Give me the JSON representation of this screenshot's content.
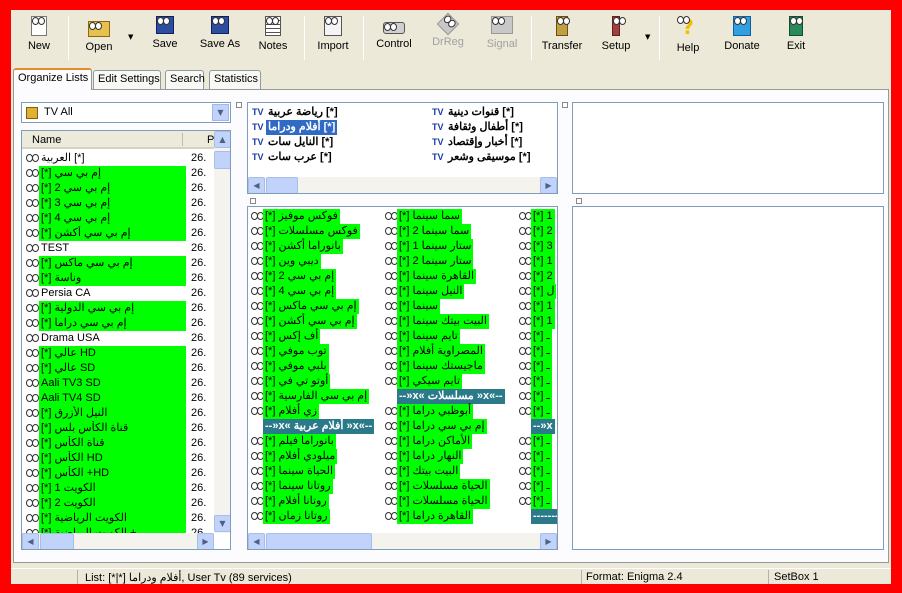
{
  "toolbar": {
    "new": "New",
    "open": "Open",
    "save": "Save",
    "save_as": "Save As",
    "notes": "Notes",
    "import": "Import",
    "control": "Control",
    "drreg": "DrReg",
    "signal": "Signal",
    "transfer": "Transfer",
    "setup": "Setup",
    "help": "Help",
    "donate": "Donate",
    "exit": "Exit"
  },
  "tabs": [
    "Organize Lists",
    "Edit Settings",
    "Search",
    "Statistics"
  ],
  "combo": {
    "value": "TV All"
  },
  "list": {
    "col_name": "Name",
    "col_num": "P",
    "rows": [
      {
        "name": "العربية [*]",
        "num": "26."
      },
      {
        "name": "[*] إم بي سي",
        "num": "26."
      },
      {
        "name": "[*] إم بي سي 2",
        "num": "26."
      },
      {
        "name": "[*] إم بي سي 3",
        "num": "26."
      },
      {
        "name": "[*] إم بي سي 4",
        "num": "26."
      },
      {
        "name": "[*] إم بي سي أكشن",
        "num": "26."
      },
      {
        "name": "TEST",
        "num": "26."
      },
      {
        "name": "[*] إم بي سي ماكس",
        "num": "26."
      },
      {
        "name": "[*] وناسة",
        "num": "26."
      },
      {
        "name": "Persia CA",
        "num": "26."
      },
      {
        "name": "[*] إم بي سي الدولية",
        "num": "26."
      },
      {
        "name": "[*] إم بي سي دراما",
        "num": "26."
      },
      {
        "name": "Drama USA",
        "num": "26."
      },
      {
        "name": "[*] عالي HD",
        "num": "26."
      },
      {
        "name": "[*] عالي SD",
        "num": "26."
      },
      {
        "name": "Aali TV3 SD",
        "num": "26."
      },
      {
        "name": "Aali TV4 SD",
        "num": "26."
      },
      {
        "name": "[*] النيل الأزرق",
        "num": "26."
      },
      {
        "name": "[*] قناة الكأس بلس",
        "num": "26."
      },
      {
        "name": "[*] قناة الكأس",
        "num": "26."
      },
      {
        "name": "[*] الكأس HD",
        "num": "26."
      },
      {
        "name": "[*] الكأس +HD",
        "num": "26."
      },
      {
        "name": "[*] الكويت 1",
        "num": "26."
      },
      {
        "name": "[*] الكويت 2",
        "num": "26."
      },
      {
        "name": "[*] الكويت الرياضية",
        "num": "26."
      },
      {
        "name": "[*] الكويت الرياضية +",
        "num": "26."
      }
    ]
  },
  "bouquets": {
    "col1": [
      "رياضة عربية [*]",
      "أفلام ودراما [*]",
      "النايل سات [*]",
      "عرب سات [*]"
    ],
    "col2": [
      "قنوات دينية [*]",
      "أطفال وثقافة [*]",
      "أخبار وإقتصاد [*]",
      "موسيقى وشعر [*]"
    ],
    "tv_label": "TV"
  },
  "services": {
    "col1": [
      {
        "name": "[*] فوكس موفيز"
      },
      {
        "name": "[*] فوكس مسلسلات"
      },
      {
        "name": "[*] بانوراما أكشن"
      },
      {
        "name": "[*] ديبي وين"
      },
      {
        "name": "[*] إم بي سي 2"
      },
      {
        "name": "[*] إم بي سي 4"
      },
      {
        "name": "[*] إم بي سي ماكس"
      },
      {
        "name": "[*] إم بي سي أكشن"
      },
      {
        "name": "[*] أف إكس"
      },
      {
        "name": "[*] توب موفي"
      },
      {
        "name": "[*] بلبي موفي"
      },
      {
        "name": "[*] أوتو تي في"
      },
      {
        "name": "[*] إم بي سي الفارسية"
      },
      {
        "name": "[*] زي أفلام"
      },
      {
        "name": "--»x« أفلام عربية »x«--",
        "hdr": true
      },
      {
        "name": "[*] بانوراما فيلم"
      },
      {
        "name": "[*] ميلودي أفلام"
      },
      {
        "name": "[*] الحياة سينما"
      },
      {
        "name": "[*] روتانا سينما"
      },
      {
        "name": "[*] روتانا أفلام"
      },
      {
        "name": "[*] روتانا زمان"
      }
    ],
    "col2": [
      {
        "name": "[*] سما سينما"
      },
      {
        "name": "[*] سما سينما 2"
      },
      {
        "name": "[*] ستار سينما 1"
      },
      {
        "name": "[*] ستار سينما 2"
      },
      {
        "name": "[*] القاهرة سينما"
      },
      {
        "name": "[*] النيل سينما"
      },
      {
        "name": "[*] سينما"
      },
      {
        "name": "[*] البيت بيتك سينما"
      },
      {
        "name": "[*] تايم سينما"
      },
      {
        "name": "[*] المصراوية أفلام"
      },
      {
        "name": "[*] ماجيستك سينما"
      },
      {
        "name": "[*] تايم سيكي"
      },
      {
        "name": "--»x« مسلسلات »x«--",
        "hdr": true
      },
      {
        "name": "[*] أبوظبي دراما"
      },
      {
        "name": "[*] إم بي سي دراما"
      },
      {
        "name": "[*] الأماكن دراما"
      },
      {
        "name": "[*] النهار دراما"
      },
      {
        "name": "[*] البيت بيتك"
      },
      {
        "name": "[*] الحياة مسلسلات"
      },
      {
        "name": "[*] الحياة مسلسلات"
      },
      {
        "name": "[*] القاهرة دراما"
      }
    ],
    "col3": [
      {
        "name": "[*] 1"
      },
      {
        "name": "[*] 2"
      },
      {
        "name": "[*] 3"
      },
      {
        "name": "[*] 1"
      },
      {
        "name": "[*] 2"
      },
      {
        "name": "[*] ل"
      },
      {
        "name": "[*] 1"
      },
      {
        "name": "[*] 1"
      },
      {
        "name": "[*] ـ"
      },
      {
        "name": "[*] ـ"
      },
      {
        "name": "[*] ـ"
      },
      {
        "name": "[*] ـ"
      },
      {
        "name": "[*] ـ"
      },
      {
        "name": "[*] ـ"
      },
      {
        "name": "--»x",
        "hdr": true
      },
      {
        "name": "[*] ـ"
      },
      {
        "name": "[*] ـ"
      },
      {
        "name": "[*] ـ"
      },
      {
        "name": "[*] ـ"
      },
      {
        "name": "[*] ـ"
      },
      {
        "name": "-------",
        "hdr": true
      }
    ]
  },
  "status": {
    "list": "List: [*|*] أفلام ودراما, User Tv (89 services)",
    "format": "Format: Enigma 2.4",
    "setbox": "SetBox 1"
  }
}
